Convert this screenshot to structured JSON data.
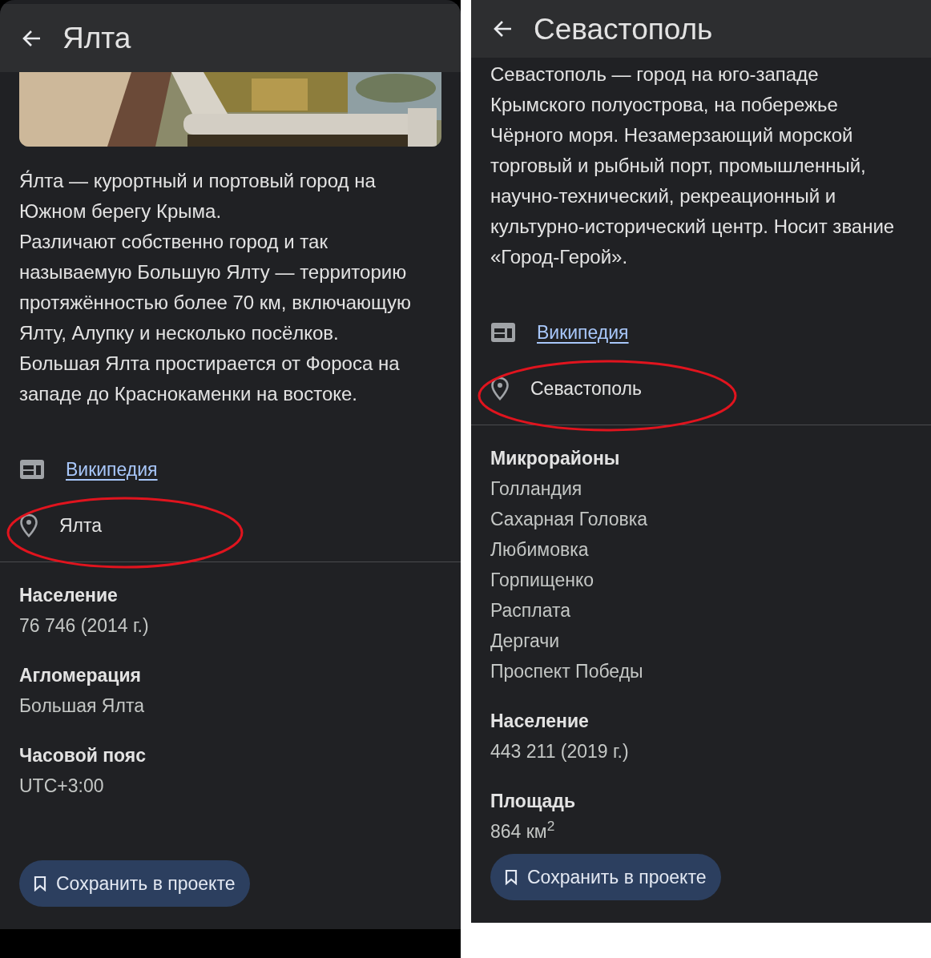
{
  "panels": [
    {
      "title": "Ялта",
      "picture": {
        "kind": "picture"
      },
      "description": [
        "Я́лта — курортный и портовый город на Южном берегу Крыма.",
        "Различают собственно город и так называемую Большую Ялту — территорию протяжённостью более 70 км, включающую Ялту, Алупку и несколько посёлков. Большая Ялта простирается от Фороса на западе до Краснокаменки на востоке."
      ],
      "links": [
        {
          "kind": "wiki",
          "label": "Википедия",
          "circled": false
        },
        {
          "kind": "place",
          "label": "Ялта",
          "circled": true
        }
      ],
      "facts": [
        {
          "label": "Население",
          "values": [
            "76 746 (2014 г.)"
          ]
        },
        {
          "label": "Агломерация",
          "values": [
            "Большая Ялта"
          ]
        },
        {
          "label": "Часовой пояс",
          "values": [
            "UTC+3:00"
          ]
        }
      ],
      "save_button": "Сохранить в проекте"
    },
    {
      "title": "Севастополь",
      "description": [
        "Севастополь — город на юго-западе Крымского полуострова, на побережье Чёрного моря. Незамерзающий морской торговый и рыбный порт, промышленный, научно-технический, рекреационный и культурно-исторический центр. Носит звание «Город-Герой»."
      ],
      "links": [
        {
          "kind": "wiki",
          "label": "Википедия",
          "circled": false
        },
        {
          "kind": "place",
          "label": "Севастополь",
          "circled": true
        }
      ],
      "facts": [
        {
          "label": "Микрорайоны",
          "values": [
            "Голландия",
            "Сахарная Головка",
            "Любимовка",
            "Горпищенко",
            "Расплата",
            "Дергачи",
            "Проспект Победы"
          ]
        },
        {
          "label": "Население",
          "values": [
            "443 211 (2019 г.)"
          ]
        },
        {
          "label": "Площадь",
          "values": [
            "864 км$^{2}$"
          ]
        }
      ],
      "save_button": "Сохранить в проекте"
    }
  ]
}
